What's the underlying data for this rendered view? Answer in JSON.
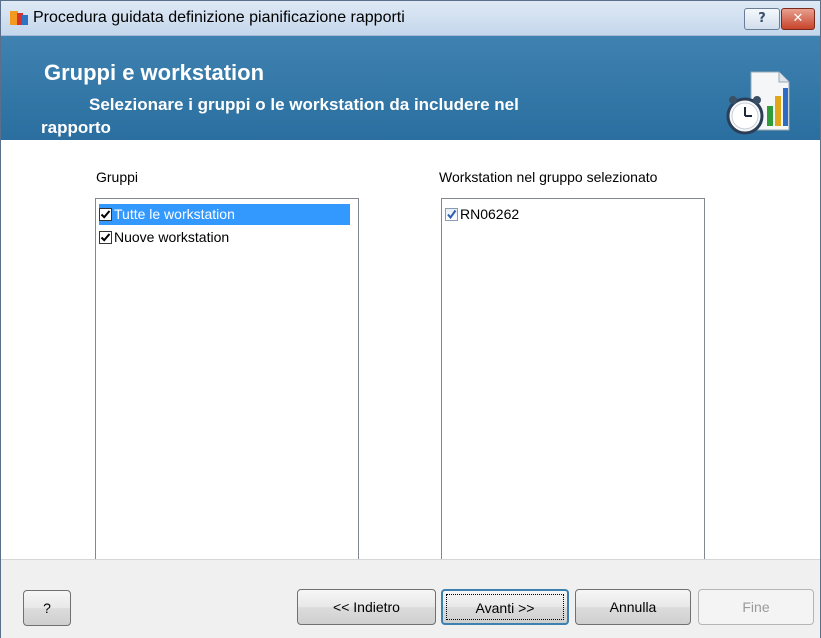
{
  "window": {
    "title": "Procedura guidata definizione pianificazione rapporti",
    "help_button": "?",
    "close_button": "✕"
  },
  "header": {
    "title": "Gruppi e workstation",
    "subtitle_line1": "Selezionare i gruppi o le workstation da includere nel",
    "subtitle_line2": "rapporto"
  },
  "groups": {
    "label": "Gruppi",
    "items": [
      {
        "label": "Tutte le workstation",
        "checked": true,
        "selected": true
      },
      {
        "label": "Nuove workstation",
        "checked": true,
        "selected": false
      }
    ]
  },
  "workstations": {
    "label": "Workstation nel gruppo selezionato",
    "items": [
      {
        "label": "RN06262",
        "checked": true
      }
    ]
  },
  "buttons": {
    "help": "?",
    "back": "<< Indietro",
    "next": "Avanti >>",
    "cancel": "Annulla",
    "finish": "Fine"
  },
  "colors": {
    "header_bg": "#2f78a8",
    "selection": "#3399ff"
  }
}
